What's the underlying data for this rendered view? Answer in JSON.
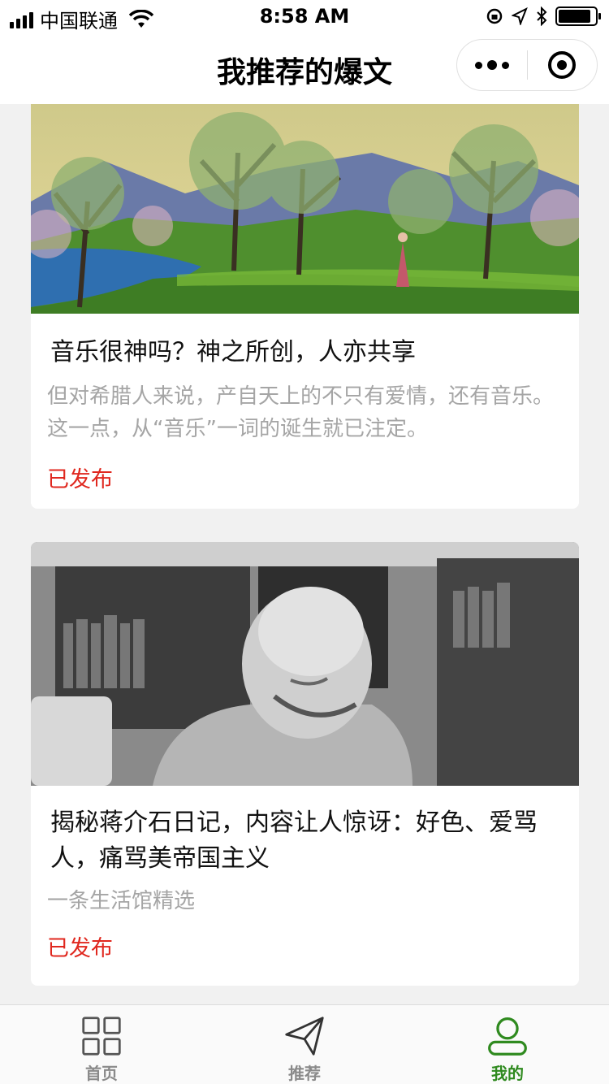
{
  "status_bar": {
    "carrier": "中国联通",
    "time": "8:58 AM",
    "battery_level": 0.9
  },
  "nav": {
    "title": "我推荐的爆文",
    "more_icon": "ellipsis-icon",
    "close_icon": "target-close-icon"
  },
  "articles": [
    {
      "title": "音乐很神吗？神之所创，人亦共享",
      "description": "但对希腊人来说，产自天上的不只有爱情，还有音乐。这一点，从“音乐”一词的诞生就已注定。",
      "status": "已发布"
    },
    {
      "title": "揭秘蒋介石日记，内容让人惊讶：好色、爱骂人，痛骂美帝国主义",
      "description": "一条生活馆精选",
      "status": "已发布"
    }
  ],
  "tabs": [
    {
      "label": "首页",
      "icon": "grid-icon",
      "active": false
    },
    {
      "label": "推荐",
      "icon": "paper-plane-icon",
      "active": false
    },
    {
      "label": "我的",
      "icon": "user-icon",
      "active": true
    }
  ],
  "colors": {
    "status_published": "#e0281f",
    "tab_active": "#2f8a1f",
    "tab_inactive": "#8a8a8a",
    "background": "#f1f1f1"
  }
}
